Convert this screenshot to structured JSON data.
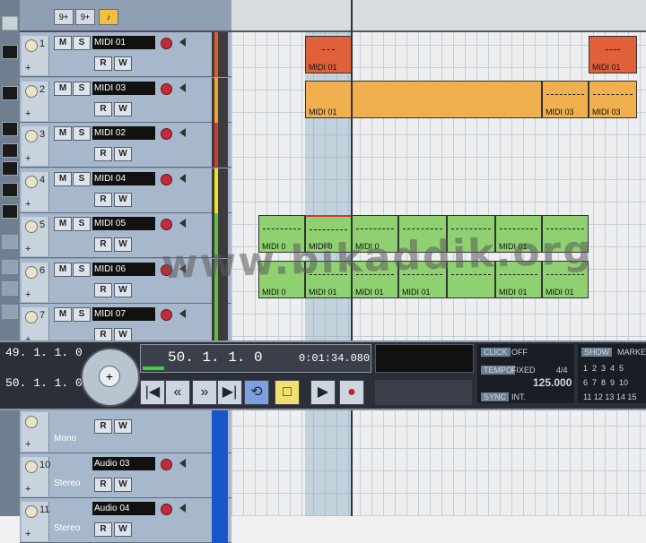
{
  "toolbar": {
    "btn1": "9+",
    "btn2": "9+",
    "btn3": "♪"
  },
  "tracks": [
    {
      "num": "1",
      "name": "MIDI 01",
      "color": "#e05a2a"
    },
    {
      "num": "2",
      "name": "MIDI 03",
      "color": "#f0a030"
    },
    {
      "num": "3",
      "name": "MIDI 02",
      "color": "#cc3a3a"
    },
    {
      "num": "4",
      "name": "MIDI 04",
      "color": "#f0e020"
    },
    {
      "num": "5",
      "name": "MIDI 05",
      "color": "#60c040"
    },
    {
      "num": "6",
      "name": "MIDI 06",
      "color": "#60c040"
    },
    {
      "num": "7",
      "name": "MIDI 07",
      "color": "#60c040"
    }
  ],
  "audio_tracks": [
    {
      "num": "",
      "name": "",
      "sub": "Mono"
    },
    {
      "num": "10",
      "name": "Audio 03",
      "sub": "Stereo"
    },
    {
      "num": "11",
      "name": "Audio 04",
      "sub": "Stereo"
    }
  ],
  "buttons": {
    "m": "M",
    "s": "S",
    "r": "R",
    "w": "W"
  },
  "parts": {
    "p1a": "MIDI 01",
    "p1b": "MIDI 01",
    "p2a": "MIDI 01",
    "p2b": "MIDI 03",
    "p2c": "MIDI 03",
    "p5a": "MIDI 0",
    "p5b": "MIDI 0",
    "p5c": "MIDI 0",
    "p5d": "MIDI 01",
    "p6a": "MIDI 0",
    "p6b": "MIDI 01",
    "p6c": "MIDI 01",
    "p6d": "MIDI 01",
    "p6e": "MIDI 01",
    "p6f": "MIDI 01",
    "p6g": "MIDI 01"
  },
  "transport": {
    "left_loc": "49. 1. 1.   0",
    "right_loc": "50. 1. 1.   0",
    "position": "50.  1.  1.    0",
    "time": "0:01:34.080",
    "click_label": "CLICK",
    "click_value": "OFF",
    "tempo_label": "TEMPO",
    "tempo_mode": "FIXED",
    "signature": "4/4",
    "tempo": "125.000",
    "sync_label": "SYNC",
    "sync_value": "INT.",
    "show_label": "SHOW",
    "marker_label": "MARKE",
    "markers_row1": "1  2  3  4  5",
    "markers_row2": "6  7  8  9  10",
    "markers_row3": "11 12 13 14 15"
  },
  "watermark": "www.bikaddik.org"
}
